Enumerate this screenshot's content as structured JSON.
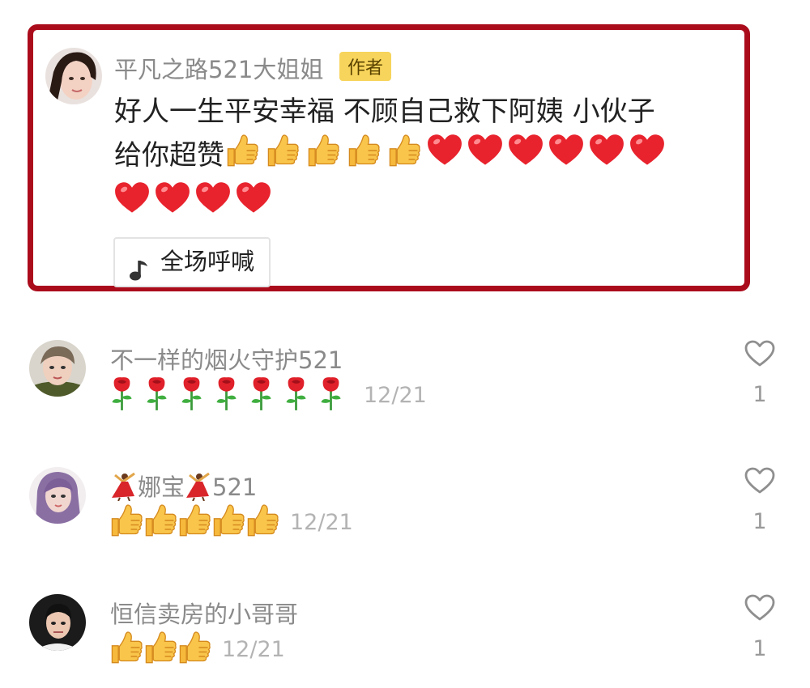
{
  "featured": {
    "username": "平凡之路521大姐姐",
    "author_badge": "作者",
    "content_line1": "好人一生平安幸福 不顾自己救下阿姨 小伙子",
    "content_line2_text": "给你超赞",
    "emoji_thumbs": 5,
    "emoji_hearts": 10,
    "shout_button": "全场呼喊"
  },
  "comments": [
    {
      "username": "不一样的烟火守护521",
      "emoji": "rose",
      "emoji_count": 7,
      "date": "12/21",
      "likes": "1"
    },
    {
      "username_suffix": "娜宝",
      "username_tail": "521",
      "emoji": "thumb",
      "emoji_count": 5,
      "date": "12/21",
      "likes": "1"
    },
    {
      "username": "恒信卖房的小哥哥",
      "emoji": "thumb",
      "emoji_count": 3,
      "date": "12/21",
      "likes": "1"
    }
  ],
  "colors": {
    "highlight_border": "#ab0c1c",
    "badge_bg": "#f7d45b",
    "heart": "#e8232d",
    "thumb": "#f6b93b"
  },
  "icons": [
    "music-note-icon",
    "heart-outline-icon",
    "thumbs-up-emoji",
    "red-heart-emoji",
    "rose-emoji",
    "dancer-emoji"
  ]
}
